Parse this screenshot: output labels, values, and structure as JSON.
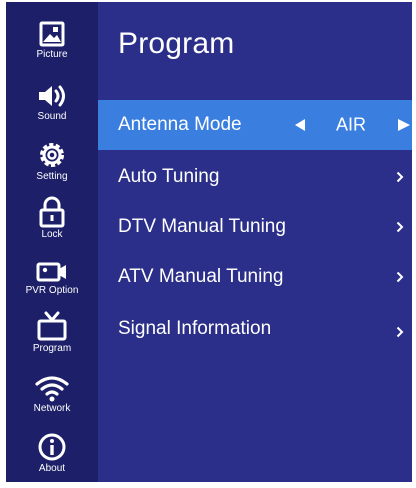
{
  "sidebar": {
    "items": [
      {
        "label": "Picture",
        "icon": "picture-icon"
      },
      {
        "label": "Sound",
        "icon": "speaker-icon"
      },
      {
        "label": "Setting",
        "icon": "gear-icon"
      },
      {
        "label": "Lock",
        "icon": "lock-icon"
      },
      {
        "label": "PVR Option",
        "icon": "video-camera-icon"
      },
      {
        "label": "Program",
        "icon": "tv-icon"
      },
      {
        "label": "Network",
        "icon": "wifi-icon"
      },
      {
        "label": "About",
        "icon": "info-icon"
      }
    ]
  },
  "main": {
    "title": "Program",
    "menu": [
      {
        "label": "Antenna Mode",
        "value": "AIR",
        "selected": true
      },
      {
        "label": "Auto Tuning"
      },
      {
        "label": "DTV Manual Tuning"
      },
      {
        "label": "ATV Manual Tuning"
      },
      {
        "label": "Signal Information"
      }
    ]
  },
  "colors": {
    "panel": "#2b2f8a",
    "sidebar": "#1d1f68",
    "selected": "#3a7fe0",
    "text": "#ffffff"
  }
}
